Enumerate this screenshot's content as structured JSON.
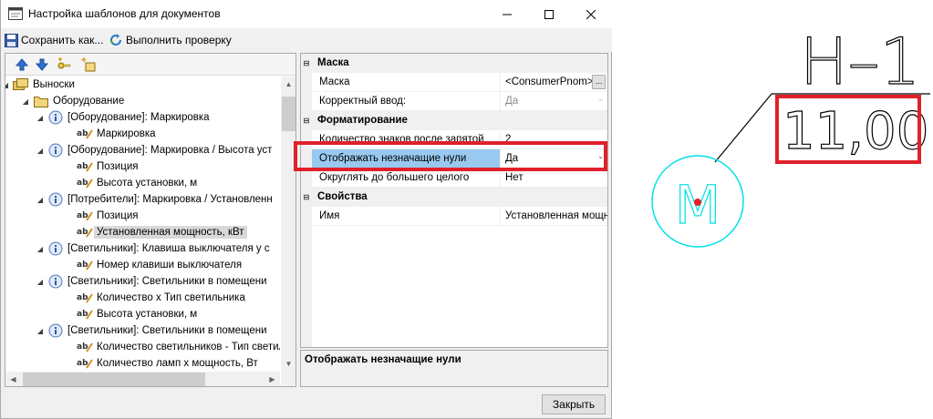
{
  "window": {
    "title": "Настройка шаблонов для документов",
    "controls": {
      "minimize": "—",
      "maximize": "☐",
      "close": "✕"
    }
  },
  "toolbar": {
    "save_label": "Сохранить как...",
    "check_label": "Выполнить проверку"
  },
  "tree": {
    "toolbar_icons": [
      "move-up-icon",
      "move-down-icon",
      "add-key-icon",
      "add-field-icon"
    ],
    "nodes": [
      {
        "label": "Выноски"
      },
      {
        "label": "Оборудование"
      },
      {
        "label": "[Оборудование]: Маркировка"
      },
      {
        "label": "Маркировка"
      },
      {
        "label": "[Оборудование]: Маркировка / Высота уст"
      },
      {
        "label": "Позиция"
      },
      {
        "label": "Высота установки, м"
      },
      {
        "label": "[Потребители]: Маркировка / Установленн"
      },
      {
        "label": "Позиция"
      },
      {
        "label": "Установленная мощность, кВт"
      },
      {
        "label": "[Светильники]: Клавиша выключателя у с"
      },
      {
        "label": "Номер клавиши выключателя"
      },
      {
        "label": "[Светильники]: Светильники в помещени"
      },
      {
        "label": "Количество х Тип светильника"
      },
      {
        "label": "Высота установки, м"
      },
      {
        "label": "[Светильники]: Светильники в помещени"
      },
      {
        "label": "Количество светильников - Тип светил"
      },
      {
        "label": "Количество ламп х мощность, Вт"
      }
    ]
  },
  "props": {
    "cat_mask": "Маска",
    "mask_name": "Маска",
    "mask_value": "<ConsumerPnom>",
    "ellipsis": "...",
    "correct_name": "Корректный ввод:",
    "correct_value": "Да",
    "cat_format": "Форматирование",
    "decimals_name": "Количество знаков после запятой",
    "decimals_value": "2",
    "zeros_name": "Отображать незначащие нули",
    "zeros_value": "Да",
    "round_name": "Округлять до большего целого",
    "round_value": "Нет",
    "cat_props": "Свойства",
    "name_name": "Имя",
    "name_value": "Установленная мощность"
  },
  "description": {
    "title": "Отображать незначащие нули"
  },
  "buttons": {
    "close": "Закрыть"
  },
  "cad": {
    "top_label": "Н–1",
    "value": "11,00",
    "symbol": "М"
  },
  "colors": {
    "highlight": "#e0202a",
    "cad_stroke": "#00e0e8",
    "cad_dot": "#e0202a",
    "selection": "#99c9ef"
  }
}
